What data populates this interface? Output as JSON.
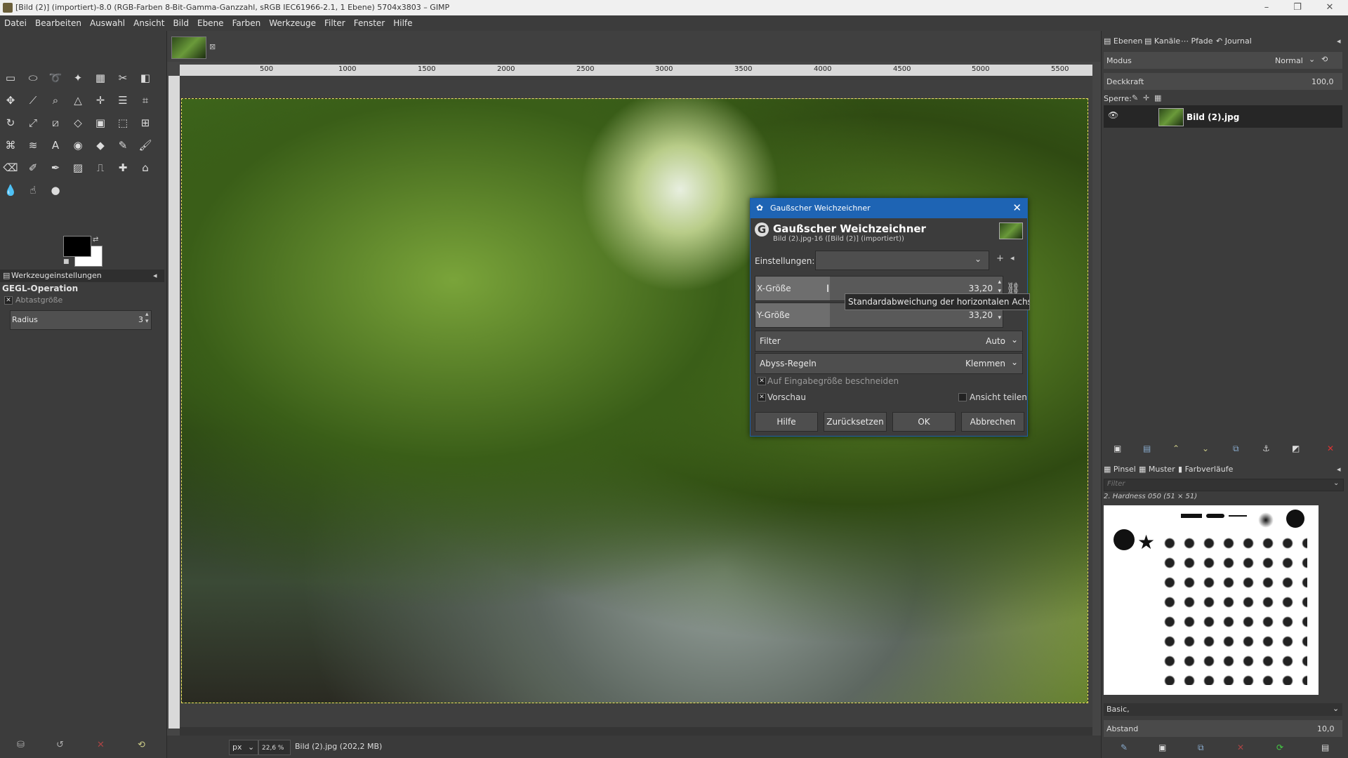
{
  "window": {
    "title": "[Bild (2)] (importiert)-8.0 (RGB-Farben 8-Bit-Gamma-Ganzzahl, sRGB IEC61966-2.1, 1 Ebene) 5704x3803 – GIMP",
    "minimize": "–",
    "maximize": "❐",
    "close": "✕"
  },
  "menu": [
    "Datei",
    "Bearbeiten",
    "Auswahl",
    "Ansicht",
    "Bild",
    "Ebene",
    "Farben",
    "Werkzeuge",
    "Filter",
    "Fenster",
    "Hilfe"
  ],
  "tool_options": {
    "tab_label": "Werkzeugeinstellungen",
    "section": "GEGL-Operation",
    "sample_label": "Abtastgröße",
    "radius_label": "Radius",
    "radius_value": "3"
  },
  "ruler": {
    "ticks": [
      "500",
      "1000",
      "1500",
      "2000",
      "2500",
      "3000",
      "3500",
      "4000",
      "4500",
      "5000",
      "5500"
    ]
  },
  "status": {
    "unit": "px",
    "zoom": "22,6 %",
    "info": "Bild (2).jpg (202,2 MB)"
  },
  "layers_panel": {
    "tabs": [
      "Ebenen",
      "Kanäle",
      "Pfade",
      "Journal"
    ],
    "mode_label": "Modus",
    "mode_value": "Normal",
    "opacity_label": "Deckkraft",
    "opacity_value": "100,0",
    "lock_label": "Sperre:",
    "layer_name": "Bild (2).jpg"
  },
  "brushes_panel": {
    "tabs": [
      "Pinsel",
      "Muster",
      "Farbverläufe"
    ],
    "filter_placeholder": "Filter",
    "selected_brush": "2. Hardness 050 (51 × 51)",
    "tag_value": "Basic,",
    "spacing_label": "Abstand",
    "spacing_value": "10,0"
  },
  "dialog": {
    "window_title": "Gaußscher Weichzeichner",
    "heading": "Gaußscher Weichzeichner",
    "subheading": "Bild (2).jpg-16 ([Bild (2)] (importiert))",
    "presets_label": "Einstellungen:",
    "x_label": "X-Größe",
    "x_value": "33,20",
    "y_label": "Y-Größe",
    "y_value": "33,20",
    "filter_label": "Filter",
    "filter_value": "Auto",
    "abyss_label": "Abyss-Regeln",
    "abyss_value": "Klemmen",
    "clip_label": "Auf Eingabegröße beschneiden",
    "preview_label": "Vorschau",
    "split_label": "Ansicht teilen",
    "buttons": {
      "help": "Hilfe",
      "reset": "Zurücksetzen",
      "ok": "OK",
      "cancel": "Abbrechen"
    },
    "tooltip": "Standardabweichung der horizontalen Achse"
  }
}
